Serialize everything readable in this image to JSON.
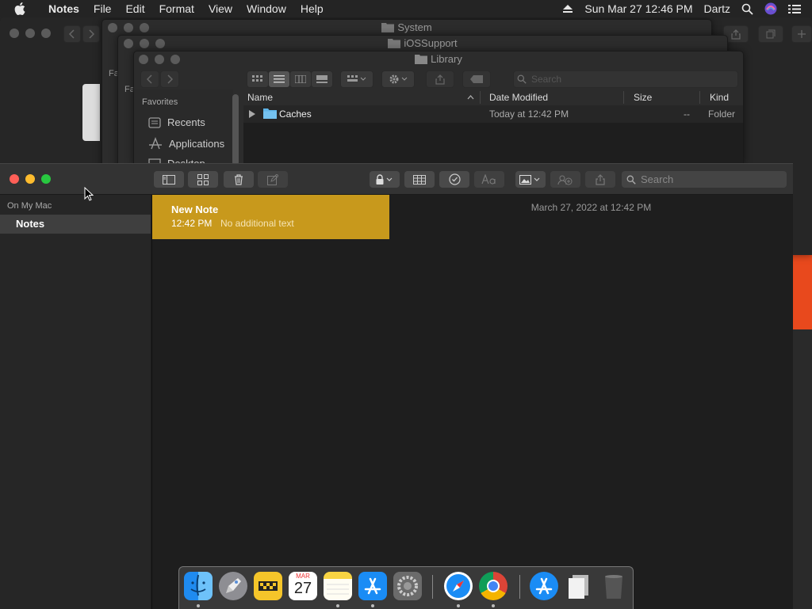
{
  "menubar": {
    "app": "Notes",
    "items": [
      "File",
      "Edit",
      "Format",
      "View",
      "Window",
      "Help"
    ],
    "datetime": "Sun Mar 27  12:46 PM",
    "user": "Dartz"
  },
  "finder": {
    "windows": [
      "System",
      "iOSSupport",
      "Library"
    ],
    "search_placeholder": "Search",
    "sidebar": {
      "header": "Favorites",
      "items": [
        "Recents",
        "Applications",
        "Desktop"
      ]
    },
    "columns": [
      "Name",
      "Date Modified",
      "Size",
      "Kind"
    ],
    "rows": [
      {
        "name": "Caches",
        "date": "Today at 12:42 PM",
        "size": "--",
        "kind": "Folder"
      }
    ],
    "back_cut_label": "Fa"
  },
  "notes": {
    "sidebar": {
      "section": "On My Mac",
      "folder": "Notes"
    },
    "list": [
      {
        "title": "New Note",
        "time": "12:42 PM",
        "preview": "No additional text"
      }
    ],
    "editor": {
      "date": "March 27, 2022 at 12:42 PM"
    },
    "search_placeholder": "Search"
  },
  "dock": {
    "apps": [
      "finder",
      "launchpad",
      "taxi",
      "calendar",
      "notes",
      "app-store",
      "system-preferences",
      "safari",
      "chrome",
      "app-store-2",
      "documents",
      "trash"
    ],
    "calendar": {
      "month": "MAR",
      "day": "27"
    }
  },
  "colors": {
    "note_selected": "#c8991c",
    "menubar_bg": "#242424",
    "window_bg": "#1e1e1e"
  }
}
